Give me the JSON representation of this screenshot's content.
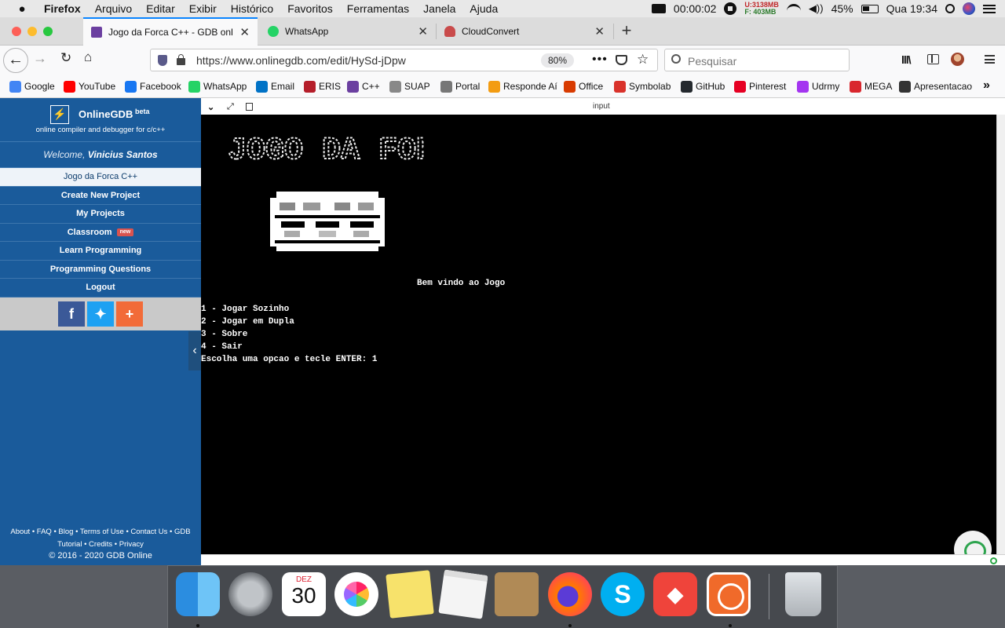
{
  "menubar": {
    "app": "Firefox",
    "items": [
      "Arquivo",
      "Editar",
      "Exibir",
      "Histórico",
      "Favoritos",
      "Ferramentas",
      "Janela",
      "Ajuda"
    ],
    "timer": "00:00:02",
    "mem_u": "U:3138MB",
    "mem_f": "F: 403MB",
    "battery": "45%",
    "clock": "Qua 19:34"
  },
  "tabs": [
    {
      "title": "Jogo da Forca C++ - GDB onlin",
      "active": true
    },
    {
      "title": "WhatsApp",
      "active": false
    },
    {
      "title": "CloudConvert",
      "active": false
    }
  ],
  "navbar": {
    "url": "https://www.onlinegdb.com/edit/HySd-jDpw",
    "zoom": "80%",
    "search_placeholder": "Pesquisar"
  },
  "bookmarks": [
    {
      "label": "Google",
      "color": "#4285f4"
    },
    {
      "label": "YouTube",
      "color": "#ff0000"
    },
    {
      "label": "Facebook",
      "color": "#1877f2"
    },
    {
      "label": "WhatsApp",
      "color": "#25d366"
    },
    {
      "label": "Email",
      "color": "#0072c6"
    },
    {
      "label": "ERIS",
      "color": "#b51e2a"
    },
    {
      "label": "C++",
      "color": "#6b3fa0"
    },
    {
      "label": "SUAP",
      "color": "#888888"
    },
    {
      "label": "Portal",
      "color": "#777777"
    },
    {
      "label": "Responde Aí",
      "color": "#f39c12"
    },
    {
      "label": "Office",
      "color": "#d83b01"
    },
    {
      "label": "Symbolab",
      "color": "#d9322b"
    },
    {
      "label": "GitHub",
      "color": "#24292e"
    },
    {
      "label": "Pinterest",
      "color": "#e60023"
    },
    {
      "label": "Udrmy",
      "color": "#a435f0"
    },
    {
      "label": "MEGA",
      "color": "#d9272e"
    },
    {
      "label": "Apresentacao",
      "color": "#333333"
    }
  ],
  "sidebar": {
    "brand": "OnlineGDB",
    "brand_sup": "beta",
    "tagline": "online compiler and debugger for c/c++",
    "welcome_prefix": "Welcome,",
    "user": "Vinicius Santos",
    "items": [
      {
        "label": "Jogo da Forca C++",
        "active": true
      },
      {
        "label": "Create New Project"
      },
      {
        "label": "My Projects"
      },
      {
        "label": "Classroom",
        "badge": "new"
      },
      {
        "label": "Learn Programming"
      },
      {
        "label": "Programming Questions"
      },
      {
        "label": "Logout"
      }
    ],
    "footer_line1": "About • FAQ • Blog • Terms of Use • Contact Us • GDB",
    "footer_line2": "Tutorial • Credits • Privacy",
    "copyright": "© 2016 - 2020 GDB Online"
  },
  "terminal": {
    "panel_label": "input",
    "title_art": "JOGO DA FORCA",
    "welcome": "Bem vindo ao Jogo",
    "menu": [
      "1 - Jogar Sozinho",
      "2 - Jogar em Dupla",
      "3 - Sobre",
      "4 - Sair"
    ],
    "prompt": "Escolha uma opcao e tecle ENTER: 1"
  },
  "dock": {
    "calendar_month": "DEZ",
    "calendar_day": "30"
  }
}
